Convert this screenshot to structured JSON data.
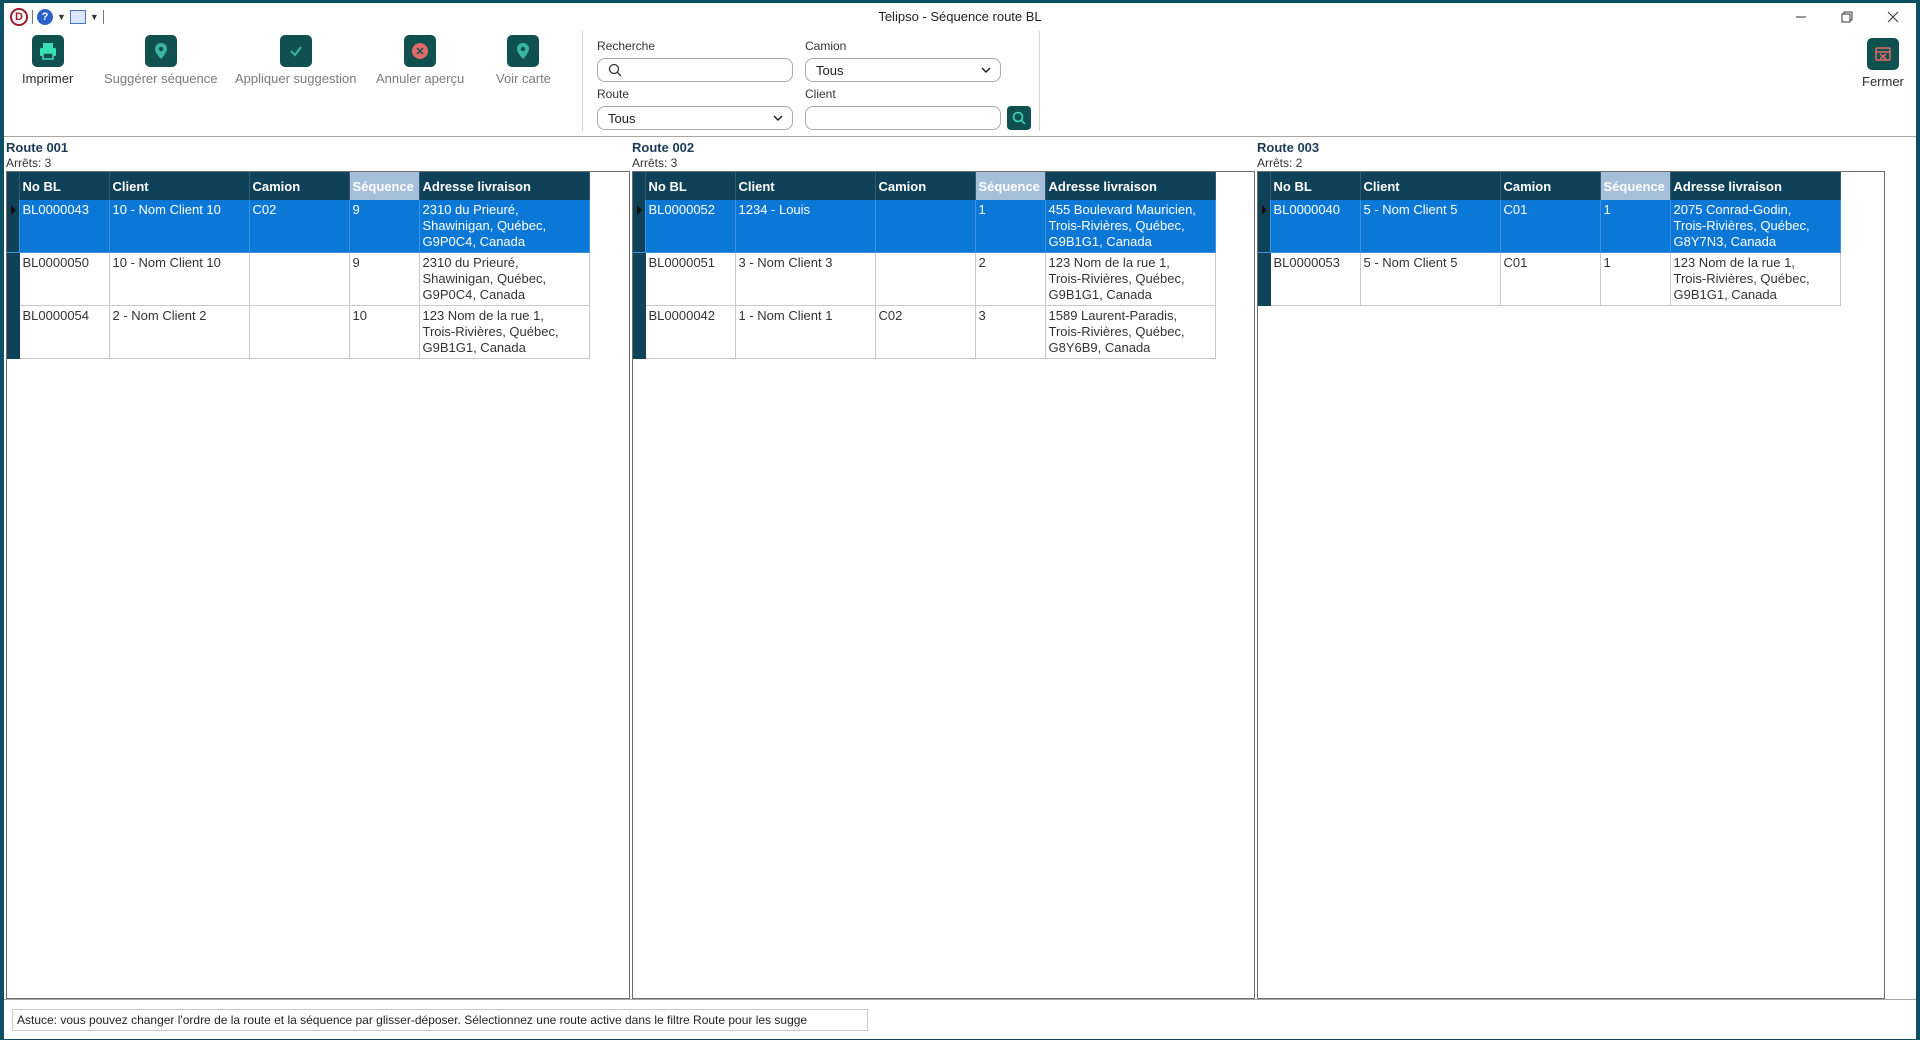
{
  "window": {
    "title": "Telipso - Séquence route BL",
    "logo_letter": "D",
    "help_glyph": "?"
  },
  "toolbar": {
    "print": "Imprimer",
    "suggest": "Suggérer séquence",
    "apply": "Appliquer suggestion",
    "cancel": "Annuler aperçu",
    "map": "Voir carte",
    "close": "Fermer"
  },
  "filters": {
    "search_label": "Recherche",
    "search_value": "",
    "camion_label": "Camion",
    "camion_value": "Tous",
    "route_label": "Route",
    "route_value": "Tous",
    "client_label": "Client",
    "client_value": ""
  },
  "columns": [
    "No BL",
    "Client",
    "Camion",
    "Séquence",
    "Adresse livraison"
  ],
  "routes": [
    {
      "title": "Route 001",
      "stops": "Arrêts: 3",
      "rows": [
        {
          "bl": "BL0000043",
          "client": "10 - Nom Client 10",
          "camion": "C02",
          "seq": "9",
          "addr1": "2310 du Prieuré,",
          "addr2": "Shawinigan, Québec,",
          "addr3": "G9P0C4, Canada"
        },
        {
          "bl": "BL0000050",
          "client": "10 - Nom Client 10",
          "camion": "",
          "seq": "9",
          "addr1": "2310 du Prieuré,",
          "addr2": "Shawinigan, Québec,",
          "addr3": "G9P0C4, Canada"
        },
        {
          "bl": "BL0000054",
          "client": "2 - Nom Client 2",
          "camion": "",
          "seq": "10",
          "addr1": "123 Nom de la rue 1,",
          "addr2": "Trois-Rivières, Québec,",
          "addr3": "G9B1G1, Canada"
        }
      ]
    },
    {
      "title": "Route 002",
      "stops": "Arrêts: 3",
      "rows": [
        {
          "bl": "BL0000052",
          "client": "1234 - Louis",
          "camion": "",
          "seq": "1",
          "addr1": "455 Boulevard Mauricien,",
          "addr2": "Trois-Rivières, Québec,",
          "addr3": "G9B1G1, Canada"
        },
        {
          "bl": "BL0000051",
          "client": "3 - Nom Client 3",
          "camion": "",
          "seq": "2",
          "addr1": "123 Nom de la rue 1,",
          "addr2": "Trois-Rivières, Québec,",
          "addr3": "G9B1G1, Canada"
        },
        {
          "bl": "BL0000042",
          "client": "1 - Nom Client 1",
          "camion": "C02",
          "seq": "3",
          "addr1": "1589 Laurent-Paradis,",
          "addr2": "Trois-Rivières, Québec,",
          "addr3": "G8Y6B9, Canada"
        }
      ]
    },
    {
      "title": "Route 003",
      "stops": "Arrêts: 2",
      "rows": [
        {
          "bl": "BL0000040",
          "client": "5 - Nom Client 5",
          "camion": "C01",
          "seq": "1",
          "addr1": "2075 Conrad-Godin,",
          "addr2": "Trois-Rivières, Québec,",
          "addr3": "G8Y7N3, Canada"
        },
        {
          "bl": "BL0000053",
          "client": "5 - Nom Client 5",
          "camion": "C01",
          "seq": "1",
          "addr1": "123 Nom de la rue 1,",
          "addr2": "Trois-Rivières, Québec,",
          "addr3": "G9B1G1, Canada"
        }
      ]
    }
  ],
  "status": {
    "tip": "Astuce: vous pouvez changer l'ordre de la route et la séquence par glisser-déposer. Sélectionnez une route active dans le filtre Route pour les sugge"
  },
  "colors": {
    "accent": "#10504f",
    "header": "#0f4159",
    "selection": "#0b78d7",
    "sequence_header": "#a5bfda"
  }
}
